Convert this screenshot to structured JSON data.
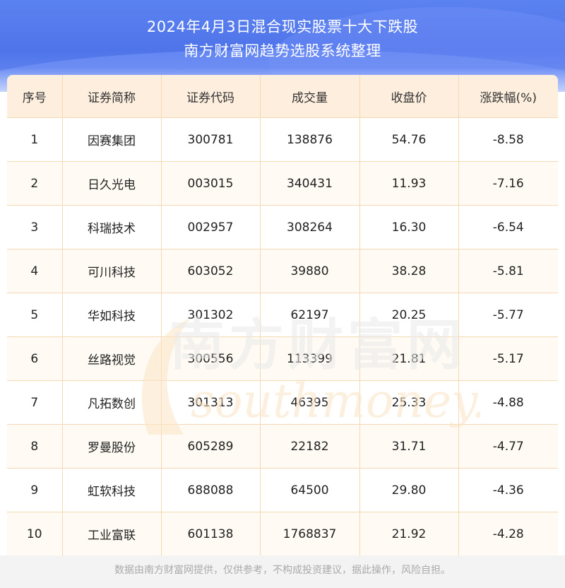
{
  "title_line1": "2024年4月3日混合现实股票十大下跌股",
  "title_line2": "南方财富网趋势选股系统整理",
  "table": {
    "headers": [
      "序号",
      "证券简称",
      "证券代码",
      "成交量",
      "收盘价",
      "涨跌幅(%)"
    ],
    "rows": [
      [
        "1",
        "因赛集团",
        "300781",
        "138876",
        "54.76",
        "-8.58"
      ],
      [
        "2",
        "日久光电",
        "003015",
        "340431",
        "11.93",
        "-7.16"
      ],
      [
        "3",
        "科瑞技术",
        "002957",
        "308264",
        "16.30",
        "-6.54"
      ],
      [
        "4",
        "可川科技",
        "603052",
        "39880",
        "38.28",
        "-5.81"
      ],
      [
        "5",
        "华如科技",
        "301302",
        "62197",
        "20.25",
        "-5.77"
      ],
      [
        "6",
        "丝路视觉",
        "300556",
        "113399",
        "21.81",
        "-5.17"
      ],
      [
        "7",
        "凡拓数创",
        "301313",
        "46395",
        "25.33",
        "-4.88"
      ],
      [
        "8",
        "罗曼股份",
        "605289",
        "22182",
        "31.71",
        "-4.77"
      ],
      [
        "9",
        "虹软科技",
        "688088",
        "64500",
        "29.80",
        "-4.36"
      ],
      [
        "10",
        "工业富联",
        "601138",
        "1768837",
        "21.92",
        "-4.28"
      ]
    ]
  },
  "watermark": {
    "cn": "南方财富网",
    "en": "southmoney.com"
  },
  "footer_text": "数据由南方财富网提供，仅供参考，不构成投资建议，据此操作，风险自担。",
  "colors": {
    "header_blue": "#4f74ea",
    "header_row_bg": "#fdeedd",
    "border": "#f4d9b5"
  }
}
